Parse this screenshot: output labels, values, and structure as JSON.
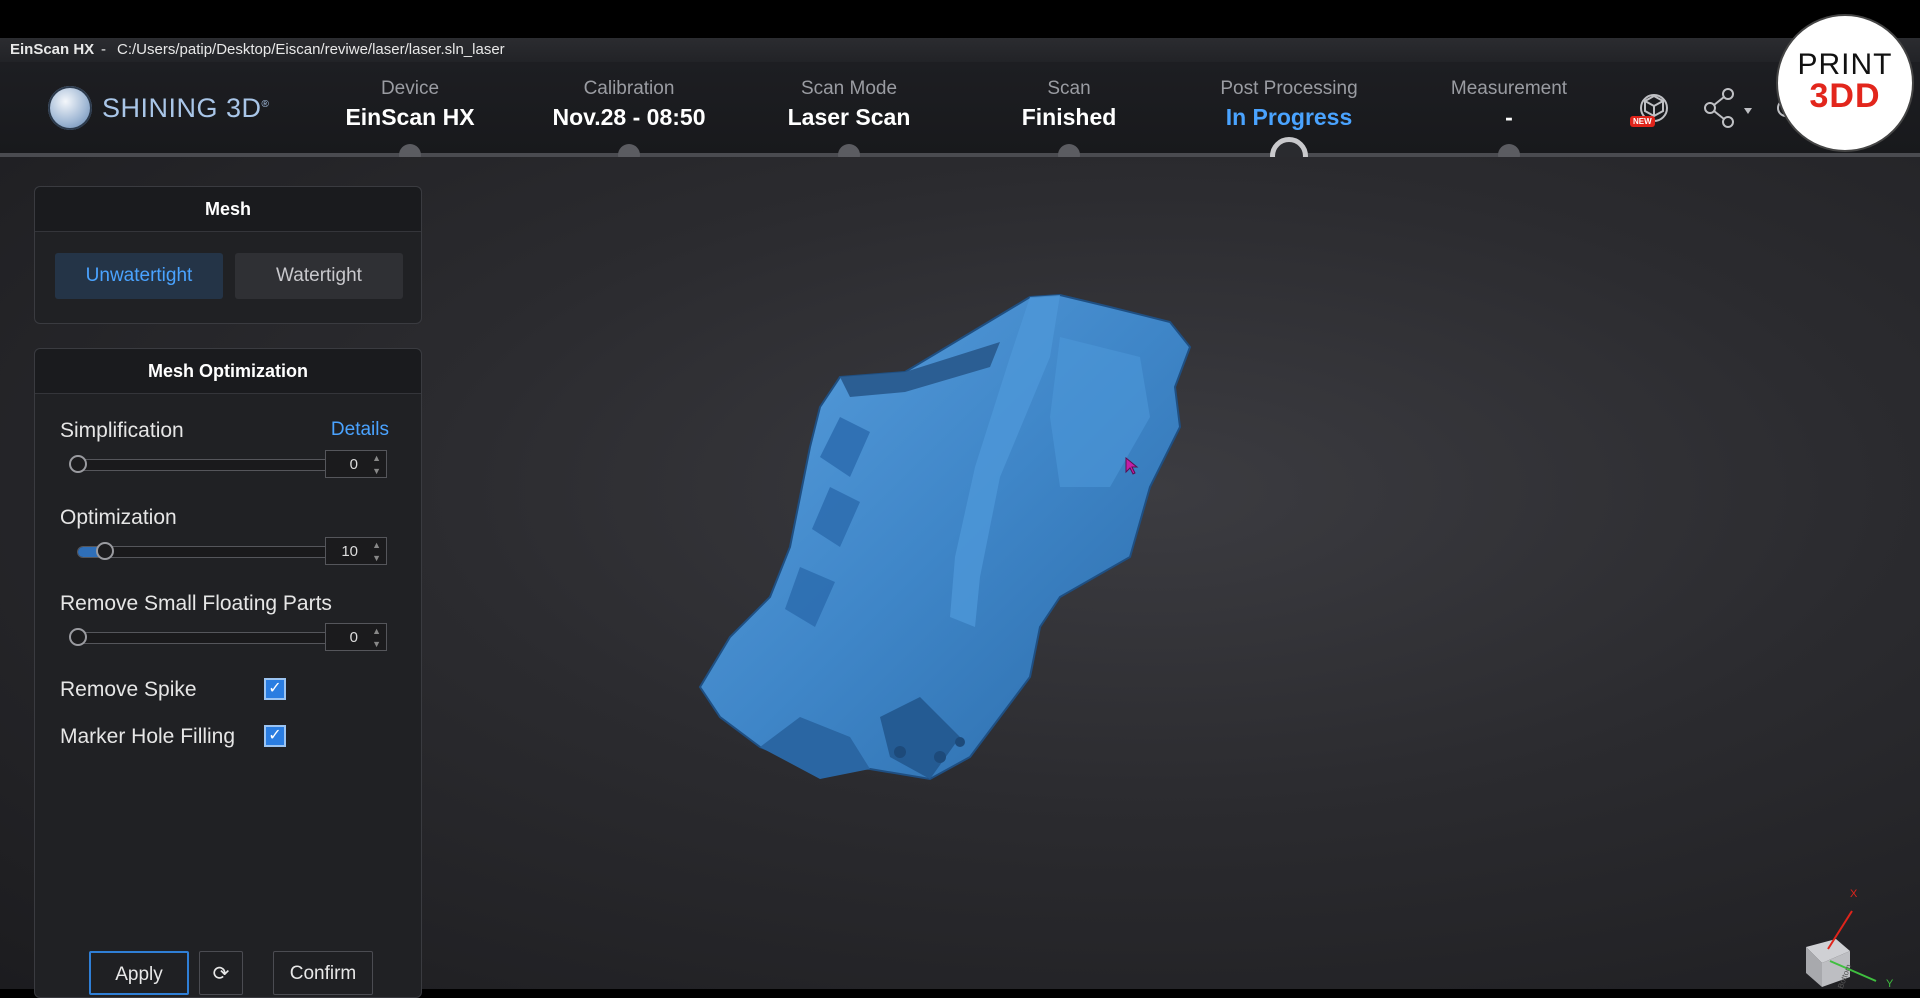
{
  "titlebar": {
    "app_name": "EinScan HX",
    "separator": "-",
    "file_path": "C:/Users/patip/Desktop/Eiscan/reviwe/laser/laser.sln_laser"
  },
  "header": {
    "logo_text": "SHINING 3D",
    "logo_mark": "®",
    "steps": [
      {
        "label": "Device",
        "value": "EinScan HX"
      },
      {
        "label": "Calibration",
        "value": "Nov.28 - 08:50"
      },
      {
        "label": "Scan Mode",
        "value": "Laser Scan"
      },
      {
        "label": "Scan",
        "value": "Finished"
      },
      {
        "label": "Post Processing",
        "value": "In Progress"
      },
      {
        "label": "Measurement",
        "value": "-"
      }
    ],
    "active_step": 4,
    "new_badge": "NEW",
    "icons": [
      "model-library-icon",
      "share-icon",
      "settings-icon"
    ],
    "brand_badge": {
      "line1": "PRINT",
      "line2": "3DD"
    }
  },
  "mesh_panel": {
    "title": "Mesh",
    "options": [
      "Unwatertight",
      "Watertight"
    ],
    "selected": "Unwatertight"
  },
  "optimization_panel": {
    "title": "Mesh Optimization",
    "simplification": {
      "label": "Simplification",
      "details_link": "Details",
      "value": "0",
      "fraction": 0.0
    },
    "optimization": {
      "label": "Optimization",
      "value": "10",
      "fraction": 0.1
    },
    "floating_parts": {
      "label": "Remove Small Floating Parts",
      "value": "0",
      "fraction": 0.0
    },
    "remove_spike": {
      "label": "Remove Spike",
      "checked": true
    },
    "marker_hole": {
      "label": "Marker Hole Filling",
      "checked": true
    },
    "buttons": {
      "apply": "Apply",
      "reset_icon": "refresh-icon",
      "confirm": "Confirm"
    }
  },
  "axis_gizmo": {
    "x_label": "X",
    "y_label": "Y",
    "cube_face": "Bottom"
  },
  "colors": {
    "accent": "#4aa3ff",
    "mesh": "#3f86c8",
    "brand_red": "#e2261c"
  }
}
